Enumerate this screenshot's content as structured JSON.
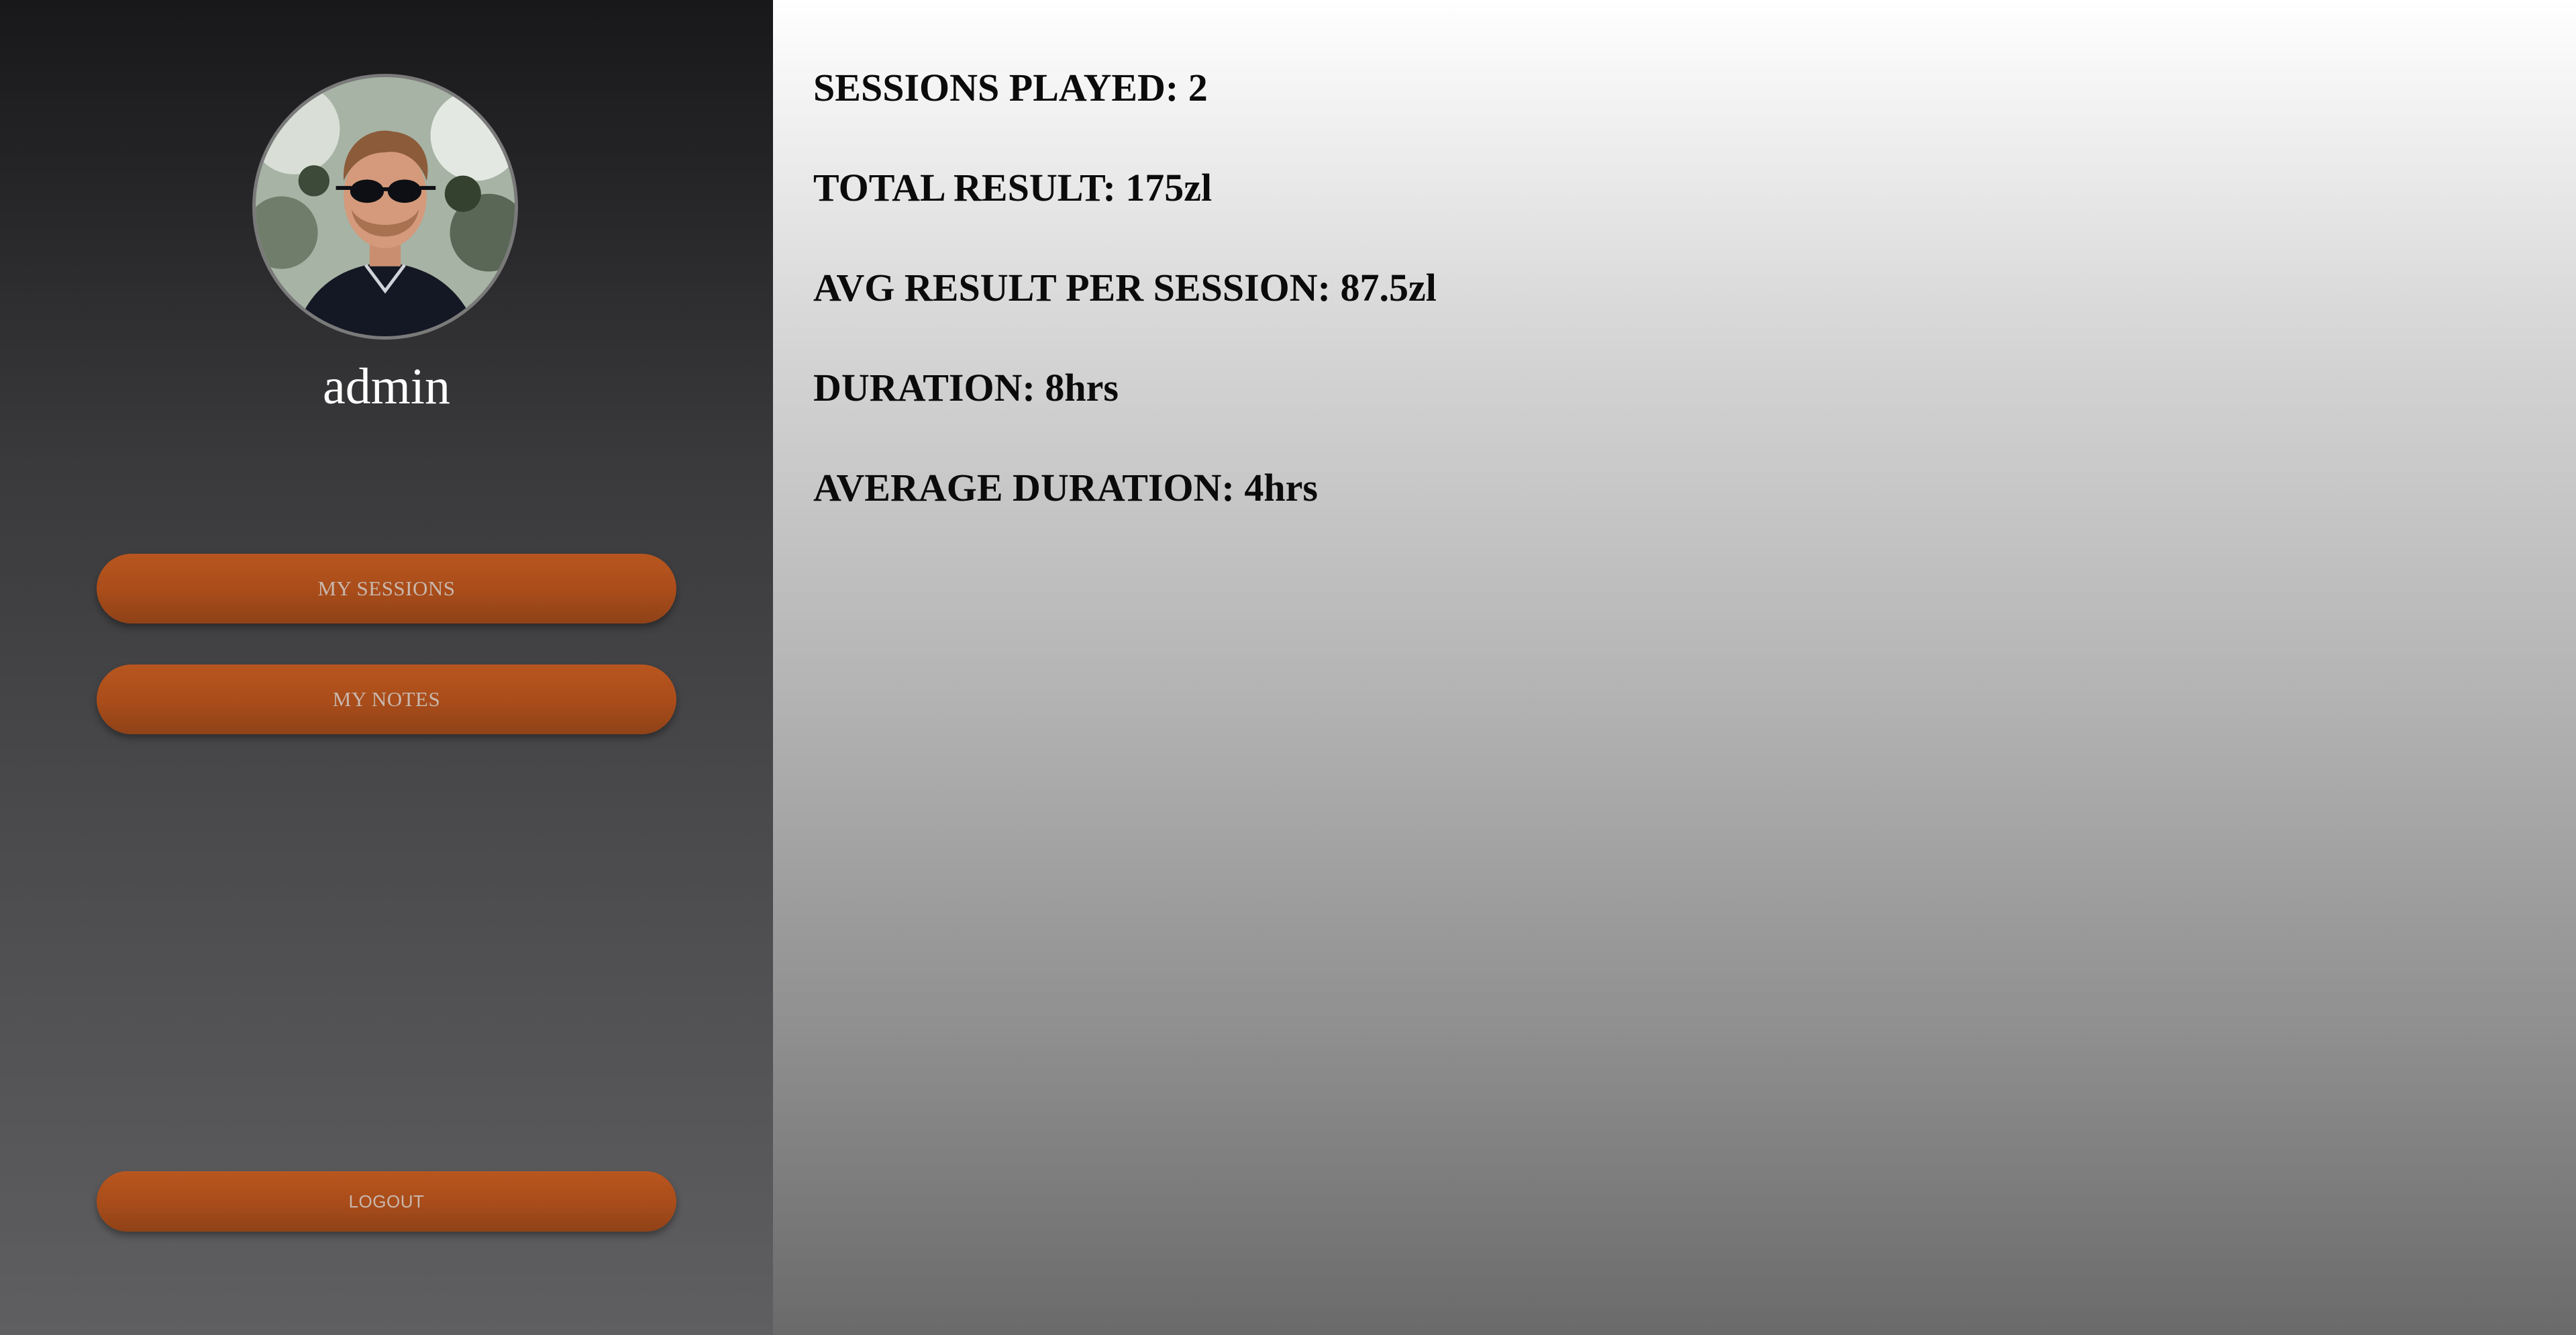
{
  "sidebar": {
    "username": "admin",
    "avatar_alt": "avatar",
    "buttons": {
      "sessions_label": "MY SESSIONS",
      "notes_label": "MY NOTES",
      "logout_label": "LOGOUT"
    }
  },
  "stats": {
    "sessions_played": {
      "label": "SESSIONS PLAYED:",
      "value": "2"
    },
    "total_result": {
      "label": "TOTAL RESULT:",
      "value": "175zl"
    },
    "avg_result": {
      "label": "AVG RESULT PER SESSION:",
      "value": "87.5zl"
    },
    "duration": {
      "label": "DURATION:",
      "value": "8hrs"
    },
    "average_duration": {
      "label": "AVERAGE DURATION:",
      "value": "4hrs"
    }
  },
  "colors": {
    "accent": "#a84c1a",
    "sidebar_top": "#18181a",
    "sidebar_bottom": "#5f5f61",
    "main_top": "#ffffff",
    "main_bottom": "#6a6a6a"
  }
}
